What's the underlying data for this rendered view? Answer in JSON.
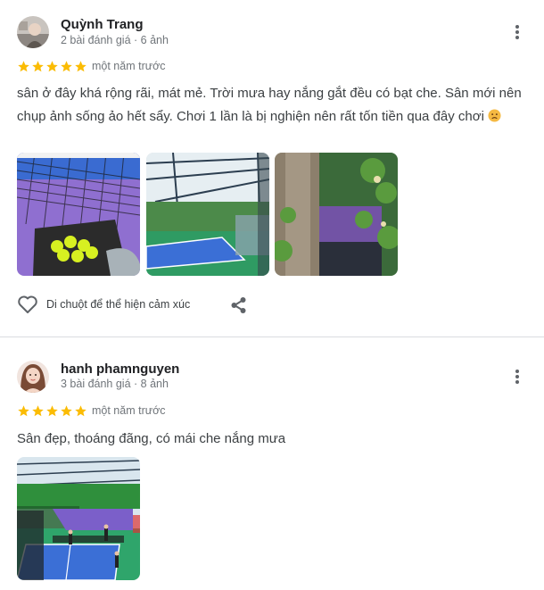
{
  "reviews": [
    {
      "name": "Quỳnh Trang",
      "meta": "2 bài đánh giá · 6 ảnh",
      "rating": 5,
      "time": "một năm trước",
      "text": "sân ở đây khá rộng rãi, mát mẻ. Trời mưa hay nắng gắt đều có bạt che. Sân mới nên chụp ảnh sống ảo hết sẩy. Chơi 1 lần là bị nghiện nên rất tốn tiền qua đây chơi",
      "reaction_label": "Di chuột để thể hiện cảm xúc"
    },
    {
      "name": "hanh phamnguyen",
      "meta": "3 bài đánh giá · 8 ảnh",
      "rating": 5,
      "time": "một năm trước",
      "text": "Sân đẹp, thoáng đãng, có mái che nắng mưa"
    }
  ],
  "colors": {
    "star": "#fbbc04",
    "court_blue": "#3b6fd6",
    "court_green": "#2e8b57",
    "purple": "#8f6fd0"
  },
  "icons": [
    "more-vert-icon",
    "star-icon",
    "heart-outline-icon",
    "share-icon",
    "sad-face-emoji"
  ]
}
